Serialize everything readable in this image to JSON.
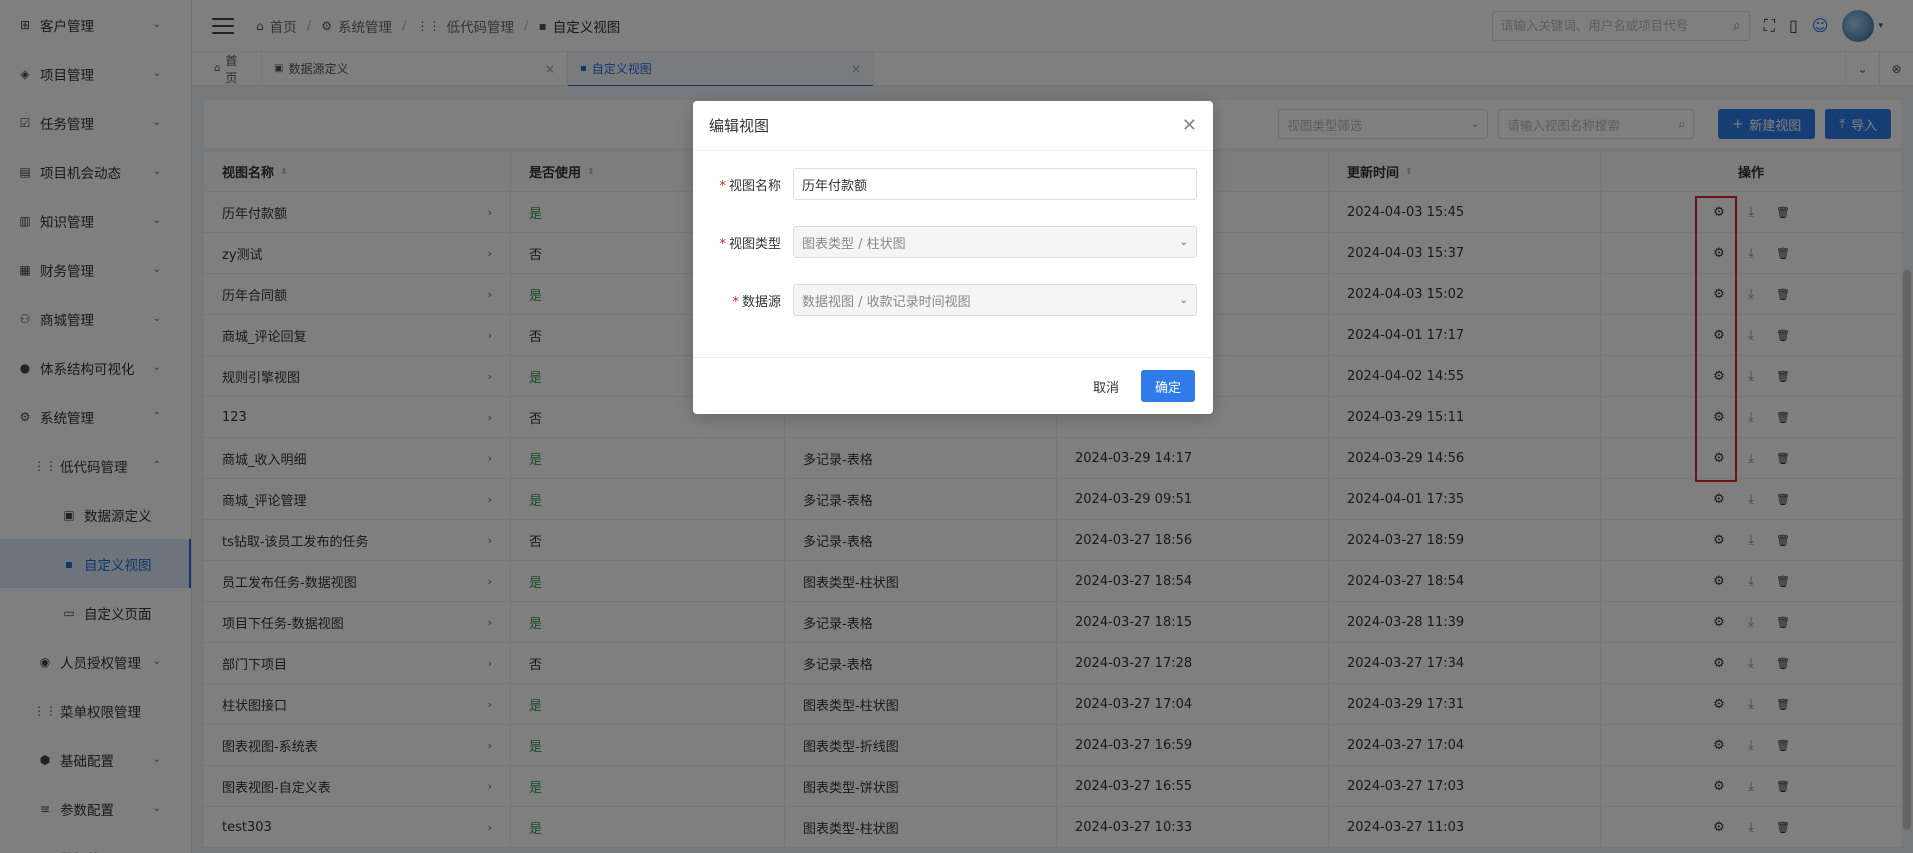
{
  "sidebar": {
    "items": [
      {
        "label": "客户管理",
        "icon": "⊞",
        "arrow": "⌄"
      },
      {
        "label": "项目管理",
        "icon": "◈",
        "arrow": "⌄"
      },
      {
        "label": "任务管理",
        "icon": "☑",
        "arrow": "⌄"
      },
      {
        "label": "项目机会动态",
        "icon": "▤",
        "arrow": "⌄"
      },
      {
        "label": "知识管理",
        "icon": "▥",
        "arrow": "⌄"
      },
      {
        "label": "财务管理",
        "icon": "▦",
        "arrow": "⌄"
      },
      {
        "label": "商城管理",
        "icon": "⚇",
        "arrow": "⌄"
      },
      {
        "label": "体系结构可视化",
        "icon": "●",
        "arrow": "⌄"
      },
      {
        "label": "系统管理",
        "icon": "⚙",
        "arrow": "⌃"
      },
      {
        "label": "低代码管理",
        "icon": "⋮⋮",
        "arrow": "⌃"
      },
      {
        "label": "数据源定义",
        "icon": "▣",
        "arrow": ""
      },
      {
        "label": "自定义视图",
        "icon": "▪",
        "arrow": ""
      },
      {
        "label": "自定义页面",
        "icon": "▭",
        "arrow": ""
      },
      {
        "label": "人员授权管理",
        "icon": "◉",
        "arrow": "⌄"
      },
      {
        "label": "菜单权限管理",
        "icon": "⋮⋮",
        "arrow": ""
      },
      {
        "label": "基础配置",
        "icon": "⬢",
        "arrow": "⌄"
      },
      {
        "label": "参数配置",
        "icon": "≡",
        "arrow": "⌄"
      },
      {
        "label": "数据处理",
        "icon": "",
        "arrow": ""
      }
    ]
  },
  "header": {
    "breadcrumb": [
      {
        "label": "首页",
        "icon": "⌂"
      },
      {
        "label": "系统管理",
        "icon": "⚙"
      },
      {
        "label": "低代码管理",
        "icon": "⋮⋮"
      },
      {
        "label": "自定义视图",
        "icon": "▪"
      }
    ],
    "search_placeholder": "请输入关键词、用户名或项目代号",
    "icons": {
      "search": "⌕",
      "fullscreen": "⛶",
      "mobile": "▯",
      "robot": "☺",
      "caret": "▾"
    }
  },
  "tabs": [
    {
      "label": "首页",
      "icon": "⌂"
    },
    {
      "label": "数据源定义",
      "icon": "▣",
      "close": "×"
    },
    {
      "label": "自定义视图",
      "icon": "▪",
      "close": "×"
    }
  ],
  "tabs_right": {
    "dropdown": "⌄",
    "close_all": "⊗"
  },
  "toolbar": {
    "type_filter_placeholder": "视图类型筛选",
    "name_search_placeholder": "请输入视图名称搜索",
    "new_view_label": "新建视图",
    "new_view_icon": "+",
    "import_label": "导入",
    "import_icon": "⤒",
    "caret": "⌄",
    "search_icon": "⌕"
  },
  "table": {
    "columns": {
      "name": "视图名称",
      "in_use": "是否使用",
      "updated": "更新时间",
      "actions": "操作",
      "sort_icon": "⬍"
    },
    "rows": [
      {
        "name": "历年付款额",
        "in_use": "是",
        "type": "",
        "created": "",
        "updated": "2024-04-03 15:45"
      },
      {
        "name": "zy测试",
        "in_use": "否",
        "type": "",
        "created": "",
        "updated": "2024-04-03 15:37"
      },
      {
        "name": "历年合同额",
        "in_use": "是",
        "type": "",
        "created": "",
        "updated": "2024-04-03 15:02"
      },
      {
        "name": "商城_评论回复",
        "in_use": "否",
        "type": "",
        "created": "",
        "updated": "2024-04-01 17:17"
      },
      {
        "name": "规则引擎视图",
        "in_use": "是",
        "type": "",
        "created": "",
        "updated": "2024-04-02 14:55"
      },
      {
        "name": "123",
        "in_use": "否",
        "type": "",
        "created": "",
        "updated": "2024-03-29 15:11"
      },
      {
        "name": "商城_收入明细",
        "in_use": "是",
        "type": "多记录-表格",
        "created": "2024-03-29 14:17",
        "updated": "2024-03-29 14:56"
      },
      {
        "name": "商城_评论管理",
        "in_use": "是",
        "type": "多记录-表格",
        "created": "2024-03-29 09:51",
        "updated": "2024-04-01 17:35"
      },
      {
        "name": "ts钻取-该员工发布的任务",
        "in_use": "否",
        "type": "多记录-表格",
        "created": "2024-03-27 18:56",
        "updated": "2024-03-27 18:59"
      },
      {
        "name": "员工发布任务-数据视图",
        "in_use": "是",
        "type": "图表类型-柱状图",
        "created": "2024-03-27 18:54",
        "updated": "2024-03-27 18:54"
      },
      {
        "name": "项目下任务-数据视图",
        "in_use": "是",
        "type": "多记录-表格",
        "created": "2024-03-27 18:15",
        "updated": "2024-03-28 11:39"
      },
      {
        "name": "部门下项目",
        "in_use": "否",
        "type": "多记录-表格",
        "created": "2024-03-27 17:28",
        "updated": "2024-03-27 17:34"
      },
      {
        "name": "柱状图接口",
        "in_use": "是",
        "type": "图表类型-柱状图",
        "created": "2024-03-27 17:04",
        "updated": "2024-03-29 17:31"
      },
      {
        "name": "图表视图-系统表",
        "in_use": "是",
        "type": "图表类型-折线图",
        "created": "2024-03-27 16:59",
        "updated": "2024-03-27 17:04"
      },
      {
        "name": "图表视图-自定义表",
        "in_use": "是",
        "type": "图表类型-饼状图",
        "created": "2024-03-27 16:55",
        "updated": "2024-03-27 17:03"
      },
      {
        "name": "test303",
        "in_use": "是",
        "type": "图表类型-柱状图",
        "created": "2024-03-27 10:33",
        "updated": "2024-03-27 11:03"
      }
    ],
    "row_icons": {
      "chevron": "›",
      "settings": "⚙",
      "download": "⤓",
      "delete": "🗑"
    }
  },
  "dialog": {
    "title": "编辑视图",
    "close_icon": "✕",
    "required_mark": "*",
    "fields": {
      "name_label": "视图名称",
      "name_value": "历年付款额",
      "type_label": "视图类型",
      "type_value": "图表类型 / 柱状图",
      "source_label": "数据源",
      "source_value": "数据视图 / 收款记录时间视图",
      "caret": "⌄"
    },
    "cancel_label": "取消",
    "ok_label": "确定"
  }
}
